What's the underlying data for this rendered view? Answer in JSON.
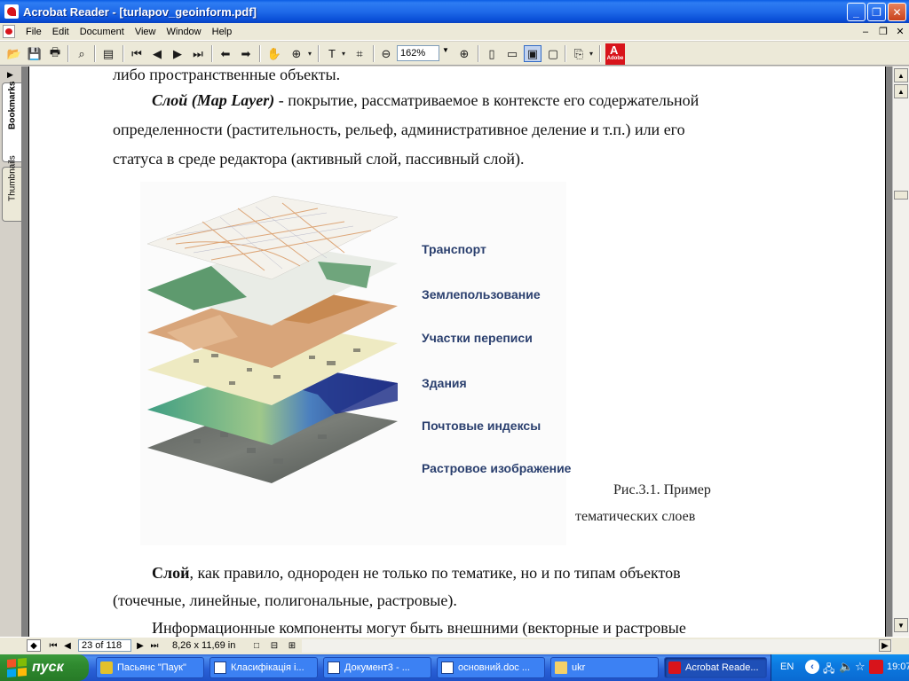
{
  "window": {
    "title": "Acrobat Reader - [turlapov_geoinform.pdf]"
  },
  "menu": [
    "File",
    "Edit",
    "Document",
    "View",
    "Window",
    "Help"
  ],
  "toolbar": {
    "zoom_value": "162%"
  },
  "nav_panel": {
    "tabs": [
      "Bookmarks",
      "Thumbnails"
    ]
  },
  "document": {
    "line_top": "либо пространственные объекты.",
    "p1_term": "Слой (Map Layer)",
    "p1_line1_rest": " - покрытие, рассматриваемое в контексте его содержательной",
    "p1_line2": "определенности (растительность, рельеф, административное деление и т.п.) или его",
    "p1_line3": "статуса в среде редактора (активный слой, пассивный слой).",
    "figure_layers": [
      "Транспорт",
      "Землепользование",
      "Участки переписи",
      "Здания",
      "Почтовые индексы",
      "Растровое изображение"
    ],
    "caption_line1": "Рис.3.1. Пример",
    "caption_line2": "тематических слоев",
    "p2_term": "Слой",
    "p2_line1_rest": ", как правило, однороден не только по тематике, но и по типам  объектов",
    "p2_line2": "(точечные, линейные, полигональные, растровые).",
    "p3_line1": "Информационные компоненты могут быть внешними (векторные и растровые"
  },
  "statusbar": {
    "page": "23 of 118",
    "page_size": "8,26 x 11,69 in"
  },
  "taskbar": {
    "start_label": "пуск",
    "tasks": [
      {
        "label": "Пасьянс \"Паук\"",
        "active": false
      },
      {
        "label": "Класифікація і...",
        "active": false
      },
      {
        "label": "Документ3 - ...",
        "active": false
      },
      {
        "label": "основний.doc ...",
        "active": false
      },
      {
        "label": "ukr",
        "active": false
      },
      {
        "label": "Acrobat Reade...",
        "active": true
      }
    ],
    "language": "EN",
    "clock": "19:07"
  }
}
